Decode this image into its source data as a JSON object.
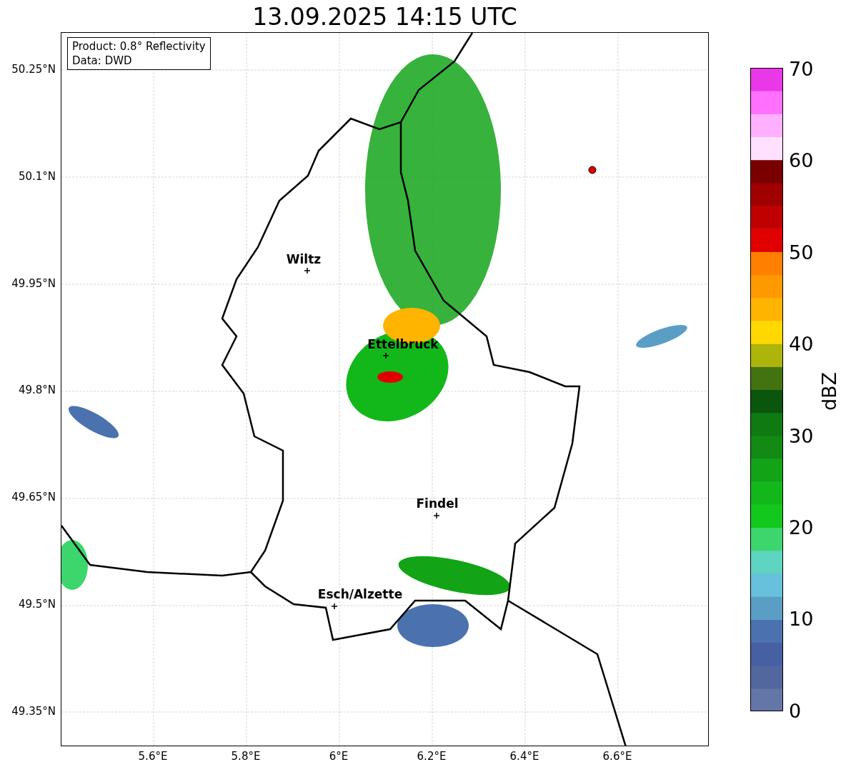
{
  "title": "13.09.2025 14:15 UTC",
  "info_box": {
    "lines": [
      "Product: 0.8° Reflectivity",
      "Data: DWD"
    ]
  },
  "map": {
    "cities": [
      {
        "name": "Wiltz"
      },
      {
        "name": "Ettelbruck"
      },
      {
        "name": "Findel"
      },
      {
        "name": "Esch/Alzette"
      }
    ]
  },
  "y_ticks": [
    "50.25°N",
    "50.1°N",
    "49.95°N",
    "49.8°N",
    "49.65°N",
    "49.5°N",
    "49.35°N"
  ],
  "x_ticks": [
    "5.6°E",
    "5.8°E",
    "6°E",
    "6.2°E",
    "6.4°E",
    "6.6°E"
  ],
  "colorbar": {
    "label": "dBZ",
    "ticks": [
      "70",
      "60",
      "50",
      "40",
      "30",
      "20",
      "10",
      "0"
    ]
  }
}
